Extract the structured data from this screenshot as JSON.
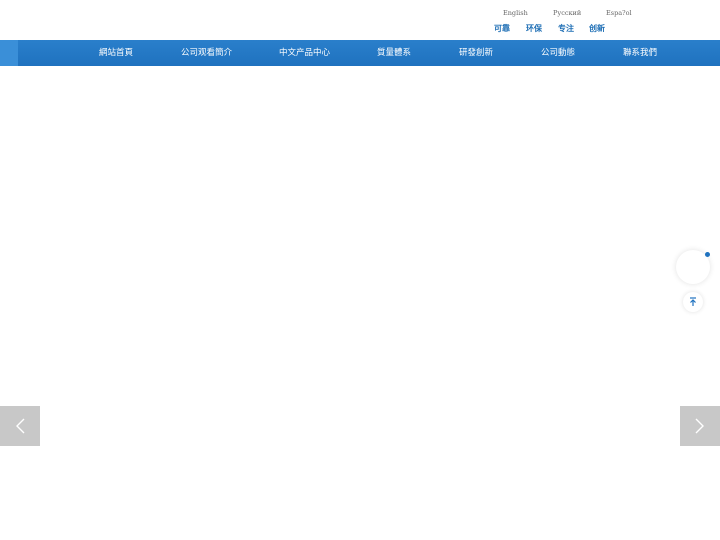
{
  "languages": [
    "English",
    "Русский",
    "Espa?ol"
  ],
  "slogans": [
    "可靠",
    "环保",
    "专注",
    "创新"
  ],
  "nav": {
    "items": [
      "網站首頁",
      "公司观看簡介",
      "中文产品中心",
      "質量體系",
      "研發創新",
      "公司動態",
      "聯系我們"
    ]
  },
  "slider": {
    "prev_icon": "chevron-left-icon",
    "next_icon": "chevron-right-icon"
  },
  "side_tools": {
    "back_to_top_icon": "arrow-up-icon"
  },
  "colors": {
    "nav_bg": "#1f72bf",
    "accent": "#1f6fb5",
    "arrow_bg": "#c8c8c8"
  }
}
